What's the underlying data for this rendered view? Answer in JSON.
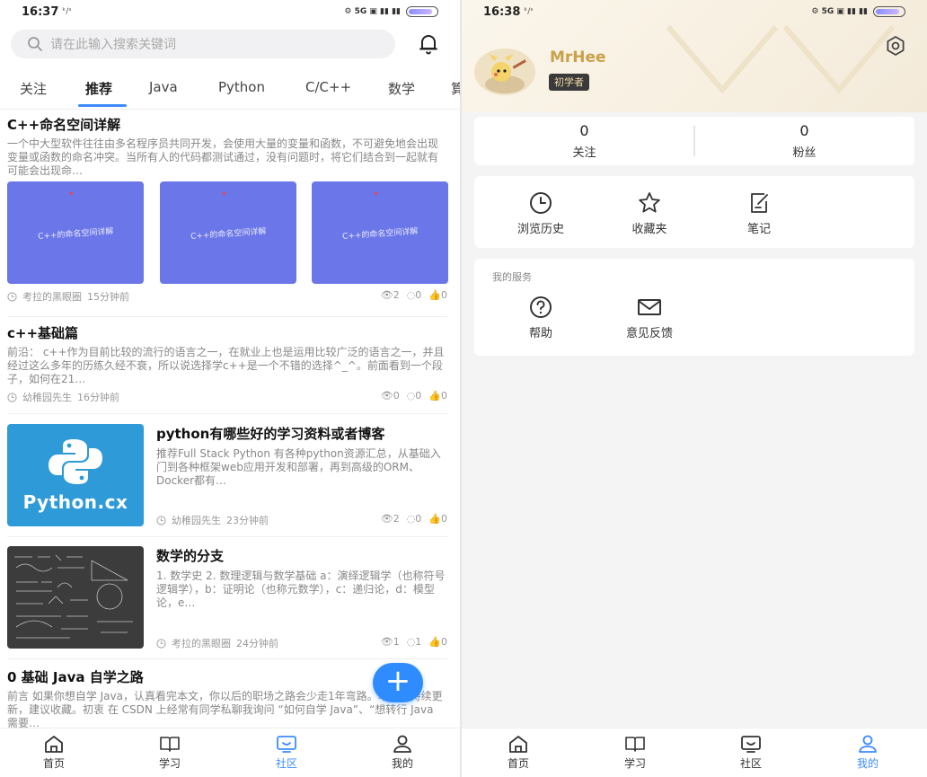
{
  "left": {
    "status": {
      "time": "16:37",
      "sub": "ᵏ/ˢ",
      "icons": "⚙ 5G ▣ ▮▮ ▮▮"
    },
    "search": {
      "placeholder": "请在此输入搜索关键词"
    },
    "tabs": [
      "关注",
      "推荐",
      "Java",
      "Python",
      "C/C++",
      "数学",
      "算"
    ],
    "active_tab_index": 1,
    "posts": [
      {
        "title": "C++命名空间详解",
        "body": "一个中大型软件往往由多名程序员共同开发，会使用大量的变量和函数，不可避免地会出现变量或函数的命名冲突。当所有人的代码都测试通过，没有问题时，将它们结合到一起就有可能会出现命…",
        "thumb_text": "C++的命名空间详解",
        "author": "考拉的黑眼圈",
        "time": "15分钟前",
        "views": "2",
        "comments": "0",
        "likes": "0"
      },
      {
        "title": "c++基础篇",
        "body": "前沿： c++作为目前比较的流行的语言之一，在就业上也是运用比较广泛的语言之一，并且经过这么多年的历练久经不衰，所以说选择学c++是一个不错的选择^_^。前面看到一个段子，如何在21…",
        "author": "幼稚园先生",
        "time": "16分钟前",
        "views": "0",
        "comments": "0",
        "likes": "0"
      },
      {
        "title": "python有哪些好的学习资料或者博客",
        "body": "推荐Full Stack Python 有各种python资源汇总，从基础入门到各种框架web应用开发和部署，再到高级的ORM、Docker都有…",
        "thumb_text": "Python.cx",
        "author": "幼稚园先生",
        "time": "23分钟前",
        "views": "2",
        "comments": "0",
        "likes": "0"
      },
      {
        "title": "数学的分支",
        "body": "1. 数学史 2. 数理逻辑与数学基础 a：演绎逻辑学（也称符号逻辑学），b：证明论（也称元数学），c：递归论，d：模型论，e…",
        "author": "考拉的黑眼圈",
        "time": "24分钟前",
        "views": "1",
        "comments": "1",
        "likes": "0"
      },
      {
        "title": "0 基础 Java 自学之路",
        "body": "前言 如果你想自学 Java，认真看完本文，你以后的职场之路会少走1年弯路。本文会持续更新，建议收藏。初衷 在 CSDN 上经常有同学私聊我询问 “如何自学 Java”、“想转行 Java 需要…"
      }
    ],
    "fab": "+",
    "nav": [
      "首页",
      "学习",
      "社区",
      "我的"
    ],
    "active_nav_index": 2
  },
  "right": {
    "status": {
      "time": "16:38",
      "sub": "ᵏ/ˢ",
      "icons": "⚙ 5G ▣ ▮▮ ▮▮"
    },
    "profile": {
      "name": "MrHee",
      "level": "初学者"
    },
    "follow": {
      "following_count": "0",
      "following_label": "关注",
      "fans_count": "0",
      "fans_label": "粉丝"
    },
    "tools": [
      "浏览历史",
      "收藏夹",
      "笔记"
    ],
    "services": {
      "title": "我的服务",
      "items": [
        "帮助",
        "意见反馈"
      ]
    },
    "nav": [
      "首页",
      "学习",
      "社区",
      "我的"
    ],
    "active_nav_index": 3
  },
  "colors": {
    "accent": "#3d8bff",
    "fab": "#2f8cff",
    "thumb": "#6b77e9",
    "python": "#2e9bd8",
    "gold": "#c9a14a"
  }
}
